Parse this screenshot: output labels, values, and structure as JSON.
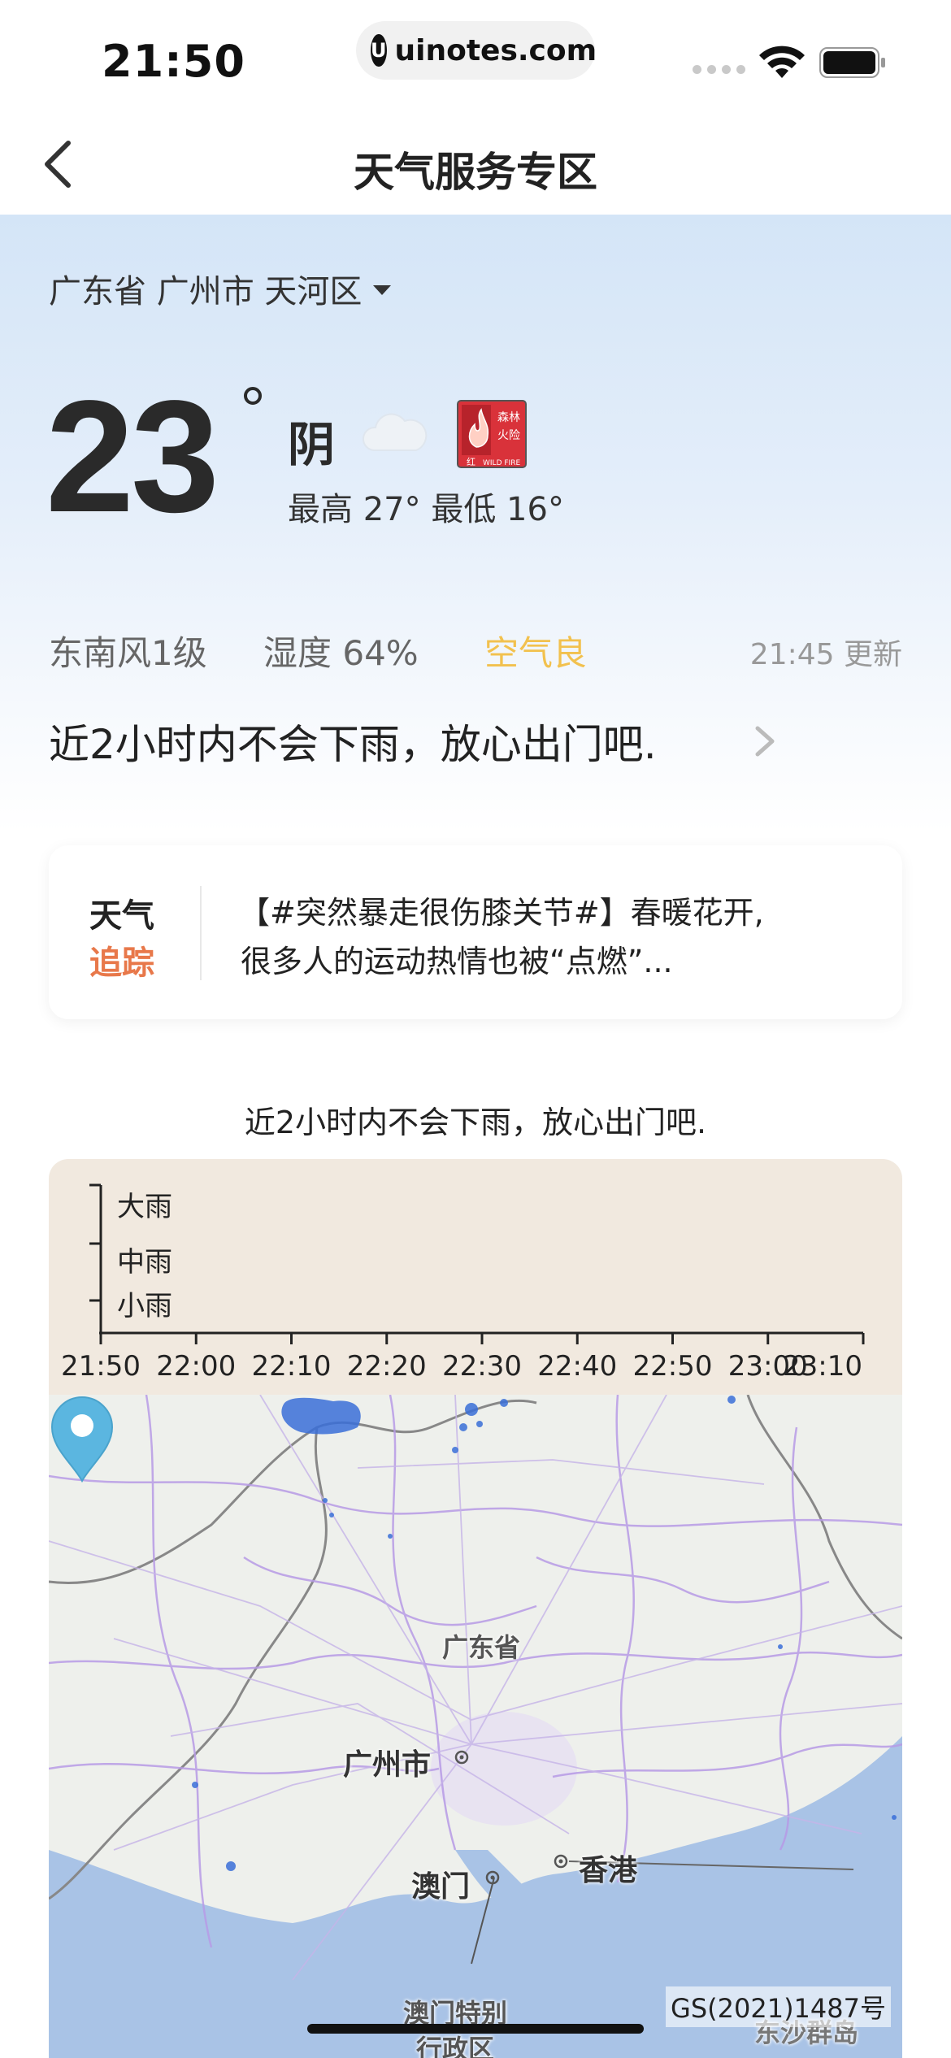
{
  "status": {
    "time": "21:50",
    "url": "uinotes.com",
    "url_logo": "U",
    "signal_icon": "cellular-signal-icon",
    "wifi_icon": "wifi-icon",
    "battery_icon": "battery-icon"
  },
  "nav": {
    "title": "天气服务专区",
    "back_icon": "chevron-left-icon"
  },
  "weather": {
    "location": "广东省 广州市 天河区",
    "temperature": "23",
    "condition": "阴",
    "high_low": "最高 27° 最低 16°",
    "warning_icon": "forest-fire-warning-icon",
    "warning_text_top": "森林",
    "warning_text_mid": "火险",
    "warning_level": "红",
    "warning_en": "WILD FIRE",
    "wind": "东南风1级",
    "humidity": "湿度 64%",
    "air_quality": "空气良",
    "air_quality_color": "#f2c14e",
    "updated": "21:45 更新",
    "rain_message": "近2小时内不会下雨，放心出门吧."
  },
  "tracking": {
    "label_line1": "天气",
    "label_line2": "追踪",
    "label2_color": "#e8784a",
    "text_line1": "【#突然暴走很伤膝关节#】春暖花开,",
    "text_line2": "很多人的运动热情也被“点燃”..."
  },
  "forecast": {
    "title": "近2小时内不会下雨，放心出门吧.",
    "y_levels": [
      "大雨",
      "中雨",
      "小雨"
    ],
    "x_ticks": [
      "21:50",
      "22:00",
      "22:10",
      "22:20",
      "22:30",
      "22:40",
      "22:50",
      "23:00",
      "23:10"
    ]
  },
  "map": {
    "labels": {
      "province": "广东省",
      "guangzhou": "广州市",
      "macau": "澳门",
      "hongkong": "香港",
      "macau_sar": "澳门特别",
      "macau_sar2": "行政区",
      "dongsha": "东沙群岛"
    },
    "approval_no": "GS(2021)1487号",
    "pin_icon": "location-pin-icon",
    "colors": {
      "water": "#a9c3e6",
      "boundary": "#b79be6",
      "road": "#c6b4e8",
      "pin": "#5bb6e0",
      "radar": "#3a6fd8"
    }
  }
}
